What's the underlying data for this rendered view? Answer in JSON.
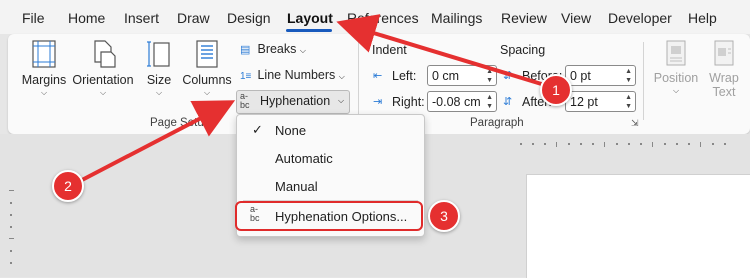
{
  "tabs": [
    "File",
    "Home",
    "Insert",
    "Draw",
    "Design",
    "Layout",
    "References",
    "Mailings",
    "Review",
    "View",
    "Developer",
    "Help"
  ],
  "ribbon": {
    "margins": "Margins",
    "orientation": "Orientation",
    "size": "Size",
    "columns": "Columns",
    "breaks": "Breaks",
    "line_numbers": "Line Numbers",
    "hyphenation": "Hyphenation",
    "page_setup_label": "Page Setup",
    "indent_label": "Indent",
    "spacing_label": "Spacing",
    "left_label": "Left:",
    "right_label": "Right:",
    "before_label": "Before:",
    "after_label": "After:",
    "left_value": "0 cm",
    "right_value": "-0.08 cm",
    "before_value": "0 pt",
    "after_value": "12 pt",
    "paragraph_label": "Paragraph",
    "position": "Position",
    "wrap_text": "Wrap Text"
  },
  "dropdown": {
    "none": "None",
    "automatic": "Automatic",
    "manual": "Manual",
    "options": "Hyphenation Options..."
  },
  "badges": [
    "1",
    "2",
    "3"
  ],
  "colors": {
    "accent": "#185abd",
    "annotation": "#e53030"
  }
}
